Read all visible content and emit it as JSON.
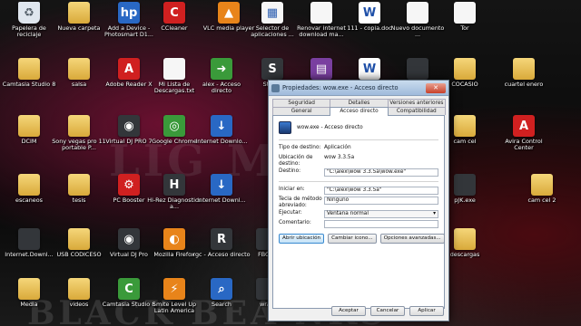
{
  "watermark_top": "LIG ML",
  "watermark_bottom": "BLACK BEA        NKS",
  "icons": [
    {
      "label": "Papelera de reciclaje",
      "kind": "bin",
      "glyph": "♻"
    },
    {
      "label": "Nueva carpeta",
      "kind": "folder",
      "glyph": ""
    },
    {
      "label": "Add a Device - Photosmart D1...",
      "kind": "blue",
      "glyph": "hp"
    },
    {
      "label": "CCleaner",
      "kind": "red",
      "glyph": "C"
    },
    {
      "label": "VLC media player",
      "kind": "orange",
      "glyph": "▲"
    },
    {
      "label": "Selector de aplicaciones ...",
      "kind": "doc",
      "glyph": "▦"
    },
    {
      "label": "Renovar internet download ma...",
      "kind": "doc",
      "glyph": ""
    },
    {
      "label": "111 - copia.doc",
      "kind": "word",
      "glyph": "W"
    },
    {
      "label": "Nuevo documento ...",
      "kind": "doc",
      "glyph": ""
    },
    {
      "label": "Tor",
      "kind": "doc",
      "glyph": ""
    },
    {
      "label": "Camtasia Studio 8",
      "kind": "folder",
      "glyph": ""
    },
    {
      "label": "salsa",
      "kind": "folder",
      "glyph": ""
    },
    {
      "label": "Adobe Reader X",
      "kind": "red",
      "glyph": "A"
    },
    {
      "label": "Mi Lista de Descargas.txt",
      "kind": "doc",
      "glyph": ""
    },
    {
      "label": "alex - Acceso directo",
      "kind": "green",
      "glyph": "➜"
    },
    {
      "label": "Steam",
      "kind": "dark",
      "glyph": "S"
    },
    {
      "label": "",
      "kind": "purple",
      "glyph": "▤"
    },
    {
      "label": "",
      "kind": "word",
      "glyph": "W"
    },
    {
      "label": "",
      "kind": "dark",
      "glyph": ""
    },
    {
      "label": "COCASIO",
      "kind": "folder",
      "glyph": ""
    },
    {
      "label": "cuartel enero",
      "kind": "folder",
      "glyph": ""
    },
    {
      "label": "DCIM",
      "kind": "folder",
      "glyph": ""
    },
    {
      "label": "Sony vegas pro 11 portable P...",
      "kind": "folder",
      "glyph": ""
    },
    {
      "label": "Virtual DJ PRO 7",
      "kind": "dark",
      "glyph": "◉"
    },
    {
      "label": "Google Chrome",
      "kind": "green",
      "glyph": "◎"
    },
    {
      "label": "Internet Downlo...",
      "kind": "blue",
      "glyph": "↓"
    },
    {
      "label": "cam cel",
      "kind": "folder",
      "glyph": ""
    },
    {
      "label": "Avira Control Center",
      "kind": "red",
      "glyph": "A"
    },
    {
      "label": "escaneos",
      "kind": "folder",
      "glyph": ""
    },
    {
      "label": "tesis",
      "kind": "folder",
      "glyph": ""
    },
    {
      "label": "PC Booster",
      "kind": "red",
      "glyph": "⚙"
    },
    {
      "label": "Hi-Rez Diagnostics a...",
      "kind": "dark",
      "glyph": "H"
    },
    {
      "label": "Internet Downl...",
      "kind": "blue",
      "glyph": "↓"
    },
    {
      "label": "pJK.exe",
      "kind": "dark",
      "glyph": ""
    },
    {
      "label": "cam cel 2",
      "kind": "folder",
      "glyph": ""
    },
    {
      "label": "Internet.Downl...",
      "kind": "dark",
      "glyph": ""
    },
    {
      "label": "USB CODICESO",
      "kind": "folder",
      "glyph": ""
    },
    {
      "label": "Virtual DJ Pro",
      "kind": "dark",
      "glyph": "◉"
    },
    {
      "label": "Mozilla Firefox",
      "kind": "orange",
      "glyph": "◐"
    },
    {
      "label": "rgc - Acceso directo",
      "kind": "dark",
      "glyph": "R"
    },
    {
      "label": "FBCIM",
      "kind": "dark",
      "glyph": ""
    },
    {
      "label": "descargas",
      "kind": "folder",
      "glyph": ""
    },
    {
      "label": "Media",
      "kind": "folder",
      "glyph": ""
    },
    {
      "label": "videos",
      "kind": "folder",
      "glyph": ""
    },
    {
      "label": "Camtasia Studio 8",
      "kind": "green",
      "glyph": "C"
    },
    {
      "label": "Smite Level Up Latin America",
      "kind": "orange",
      "glyph": "⚡"
    },
    {
      "label": "Search",
      "kind": "blue",
      "glyph": "⌕"
    },
    {
      "label": "wra5",
      "kind": "dark",
      "glyph": ""
    }
  ],
  "dialog": {
    "title": "Propiedades: wow.exe - Acceso directo",
    "close_glyph": "✕",
    "tabs_row1": [
      "Seguridad",
      "Detalles",
      "Versiones anteriores"
    ],
    "tabs_row2": [
      "General",
      "Acceso directo",
      "Compatibilidad"
    ],
    "active_tab": "Acceso directo",
    "app_name": "wow.exe - Acceso directo",
    "fields": {
      "tipo_label": "Tipo de destino:",
      "tipo_value": "Aplicación",
      "ubicacion_label": "Ubicación de destino:",
      "ubicacion_value": "wow 3.3.5a",
      "destino_label": "Destino:",
      "destino_value": "\"C:\\alex\\wow 3.3.5a\\wow.exe\"",
      "iniciar_label": "Iniciar en:",
      "iniciar_value": "\"C:\\alex\\wow 3.3.5a\"",
      "tecla_label": "Tecla de método abreviado:",
      "tecla_value": "Ninguno",
      "ejecutar_label": "Ejecutar:",
      "ejecutar_value": "Ventana normal",
      "comentario_label": "Comentario:",
      "comentario_value": ""
    },
    "buttons": {
      "abrir": "Abrir ubicación",
      "cambiar": "Cambiar icono...",
      "avanzadas": "Opciones avanzadas...",
      "aceptar": "Aceptar",
      "cancelar": "Cancelar",
      "aplicar": "Aplicar"
    }
  }
}
